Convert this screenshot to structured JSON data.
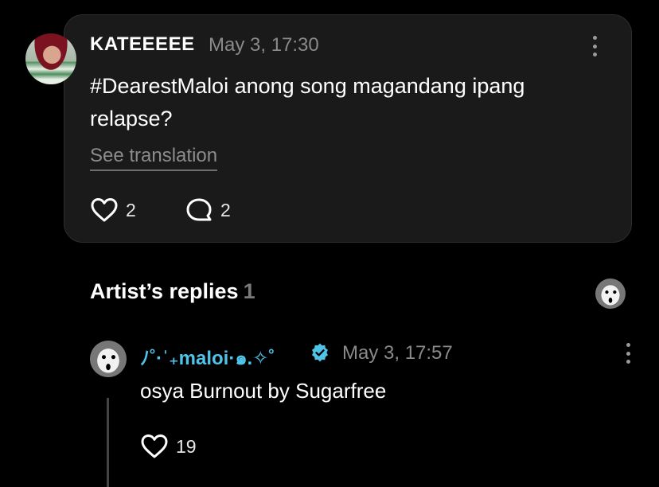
{
  "post": {
    "author": "KATEEEEE",
    "timestamp": "May 3, 17:30",
    "text": "#DearestMaloi anong song magandang ipang relapse?",
    "see_translation": "See translation",
    "likes": "2",
    "comments": "2",
    "menu_icon": "more-vertical-icon",
    "like_icon": "heart-icon",
    "comment_icon": "comment-bubble-icon"
  },
  "replies_section": {
    "title": "Artist’s replies",
    "count": "1"
  },
  "reply": {
    "author": "ﾉ˚·ˈ₊maloi·๑.✧˚",
    "verified_icon": "verified-badge-icon",
    "timestamp": "May 3, 17:57",
    "text": "osya Burnout by Sugarfree",
    "likes": "19",
    "menu_icon": "more-vertical-icon",
    "like_icon": "heart-icon"
  },
  "colors": {
    "background": "#000000",
    "card": "#1a1a1a",
    "artist_name": "#4fc3e8",
    "muted_text": "#8a8a8a"
  }
}
